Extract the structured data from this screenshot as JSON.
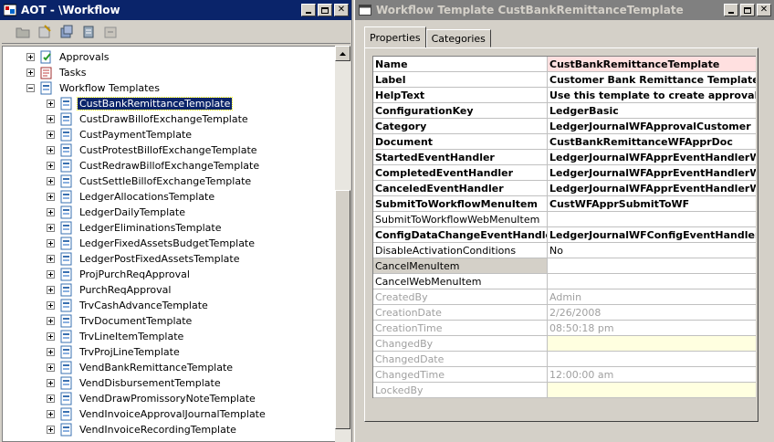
{
  "aot": {
    "title": "AOT - \\Workflow",
    "tree": [
      {
        "label": "Approvals",
        "level": 1,
        "expander": "plus",
        "icon": "approval-icon"
      },
      {
        "label": "Tasks",
        "level": 1,
        "expander": "plus",
        "icon": "task-icon"
      },
      {
        "label": "Workflow Templates",
        "level": 1,
        "expander": "minus",
        "icon": "template-folder-icon"
      },
      {
        "label": "CustBankRemittanceTemplate",
        "level": 2,
        "expander": "plus",
        "icon": "template-icon",
        "selected": true
      },
      {
        "label": "CustDrawBillofExchangeTemplate",
        "level": 2,
        "expander": "plus",
        "icon": "template-icon"
      },
      {
        "label": "CustPaymentTemplate",
        "level": 2,
        "expander": "plus",
        "icon": "template-icon"
      },
      {
        "label": "CustProtestBillofExchangeTemplate",
        "level": 2,
        "expander": "plus",
        "icon": "template-icon"
      },
      {
        "label": "CustRedrawBillofExchangeTemplate",
        "level": 2,
        "expander": "plus",
        "icon": "template-icon"
      },
      {
        "label": "CustSettleBillofExchangeTemplate",
        "level": 2,
        "expander": "plus",
        "icon": "template-icon"
      },
      {
        "label": "LedgerAllocationsTemplate",
        "level": 2,
        "expander": "plus",
        "icon": "template-icon"
      },
      {
        "label": "LedgerDailyTemplate",
        "level": 2,
        "expander": "plus",
        "icon": "template-icon"
      },
      {
        "label": "LedgerEliminationsTemplate",
        "level": 2,
        "expander": "plus",
        "icon": "template-icon"
      },
      {
        "label": "LedgerFixedAssetsBudgetTemplate",
        "level": 2,
        "expander": "plus",
        "icon": "template-icon"
      },
      {
        "label": "LedgerPostFixedAssetsTemplate",
        "level": 2,
        "expander": "plus",
        "icon": "template-icon"
      },
      {
        "label": "ProjPurchReqApproval",
        "level": 2,
        "expander": "plus",
        "icon": "template-icon"
      },
      {
        "label": "PurchReqApproval",
        "level": 2,
        "expander": "plus",
        "icon": "template-icon"
      },
      {
        "label": "TrvCashAdvanceTemplate",
        "level": 2,
        "expander": "plus",
        "icon": "template-icon"
      },
      {
        "label": "TrvDocumentTemplate",
        "level": 2,
        "expander": "plus",
        "icon": "template-icon"
      },
      {
        "label": "TrvLineItemTemplate",
        "level": 2,
        "expander": "plus",
        "icon": "template-icon"
      },
      {
        "label": "TrvProjLineTemplate",
        "level": 2,
        "expander": "plus",
        "icon": "template-icon"
      },
      {
        "label": "VendBankRemittanceTemplate",
        "level": 2,
        "expander": "plus",
        "icon": "template-icon"
      },
      {
        "label": "VendDisbursementTemplate",
        "level": 2,
        "expander": "plus",
        "icon": "template-icon"
      },
      {
        "label": "VendDrawPromissoryNoteTemplate",
        "level": 2,
        "expander": "plus",
        "icon": "template-icon"
      },
      {
        "label": "VendInvoiceApprovalJournalTemplate",
        "level": 2,
        "expander": "plus",
        "icon": "template-icon"
      },
      {
        "label": "VendInvoiceRecordingTemplate",
        "level": 2,
        "expander": "plus",
        "icon": "template-icon"
      }
    ]
  },
  "wft": {
    "title": "Workflow Template CustBankRemittanceTemplate",
    "tabs": [
      "Properties",
      "Categories"
    ],
    "properties": [
      {
        "name": "Name",
        "value": "CustBankRemittanceTemplate",
        "style": "bold",
        "valstyle": "pink"
      },
      {
        "name": "Label",
        "value": "Customer Bank Remittance Template",
        "style": "bold"
      },
      {
        "name": "HelpText",
        "value": "Use this template to create approval wo",
        "style": "bold"
      },
      {
        "name": "ConfigurationKey",
        "value": "LedgerBasic",
        "style": "bold"
      },
      {
        "name": "Category",
        "value": "LedgerJournalWFApprovalCustomer",
        "style": "bold"
      },
      {
        "name": "Document",
        "value": "CustBankRemittanceWFApprDoc",
        "style": "bold"
      },
      {
        "name": "StartedEventHandler",
        "value": "LedgerJournalWFApprEventHandlerWF",
        "style": "bold"
      },
      {
        "name": "CompletedEventHandler",
        "value": "LedgerJournalWFApprEventHandlerWF",
        "style": "bold"
      },
      {
        "name": "CanceledEventHandler",
        "value": "LedgerJournalWFApprEventHandlerWF",
        "style": "bold"
      },
      {
        "name": "SubmitToWorkflowMenuItem",
        "value": "CustWFApprSubmitToWF",
        "style": "bold"
      },
      {
        "name": "SubmitToWorkflowWebMenuItem",
        "value": "",
        "style": "normal"
      },
      {
        "name": "ConfigDataChangeEventHandler",
        "value": "LedgerJournalWFConfigEventHandler",
        "style": "bold"
      },
      {
        "name": "DisableActivationConditions",
        "value": "No",
        "style": "normal"
      },
      {
        "name": "CancelMenuItem",
        "value": "",
        "style": "normal",
        "namestyle": "hl"
      },
      {
        "name": "CancelWebMenuItem",
        "value": "",
        "style": "normal"
      },
      {
        "name": "CreatedBy",
        "value": "Admin",
        "style": "grey"
      },
      {
        "name": "CreationDate",
        "value": "2/26/2008",
        "style": "grey"
      },
      {
        "name": "CreationTime",
        "value": "08:50:18 pm",
        "style": "grey"
      },
      {
        "name": "ChangedBy",
        "value": "",
        "style": "grey",
        "valstyle": "cream"
      },
      {
        "name": "ChangedDate",
        "value": "",
        "style": "grey"
      },
      {
        "name": "ChangedTime",
        "value": "12:00:00 am",
        "style": "grey"
      },
      {
        "name": "LockedBy",
        "value": "",
        "style": "grey",
        "valstyle": "cream"
      }
    ]
  }
}
